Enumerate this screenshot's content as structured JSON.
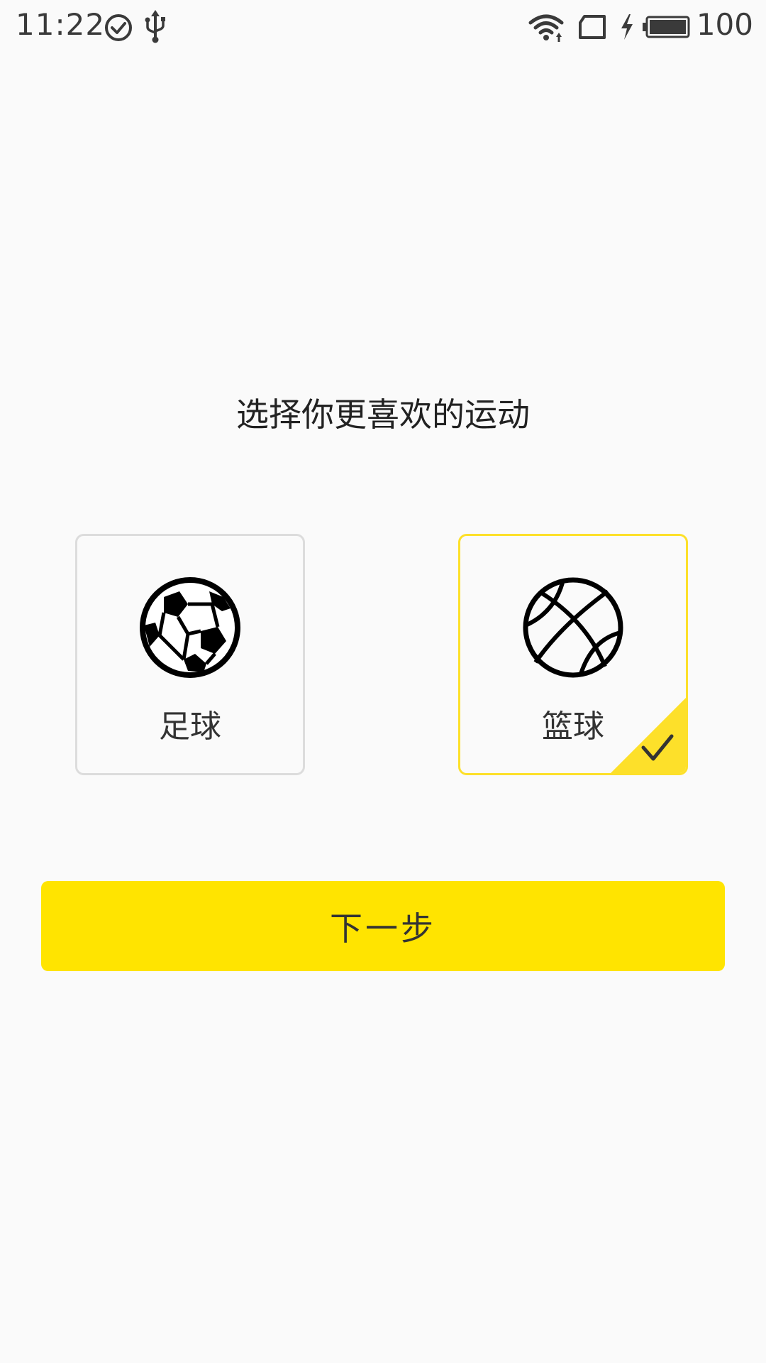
{
  "status_bar": {
    "time": "11:22",
    "battery_level": "100",
    "icons": [
      "check-circle-icon",
      "usb-icon",
      "wifi-icon",
      "screen-rotate-icon",
      "charging-icon",
      "battery-icon"
    ]
  },
  "prompt": {
    "title": "选择你更喜欢的运动"
  },
  "options": [
    {
      "label": "足球",
      "icon": "soccer-ball-icon",
      "selected": false
    },
    {
      "label": "篮球",
      "icon": "basketball-icon",
      "selected": true
    }
  ],
  "next_button": {
    "label": "下一步"
  },
  "colors": {
    "accent": "#ffe400",
    "selected_border": "#fde02a",
    "card_border": "#dcdcdc",
    "background": "#fafafa",
    "text": "#333333"
  }
}
